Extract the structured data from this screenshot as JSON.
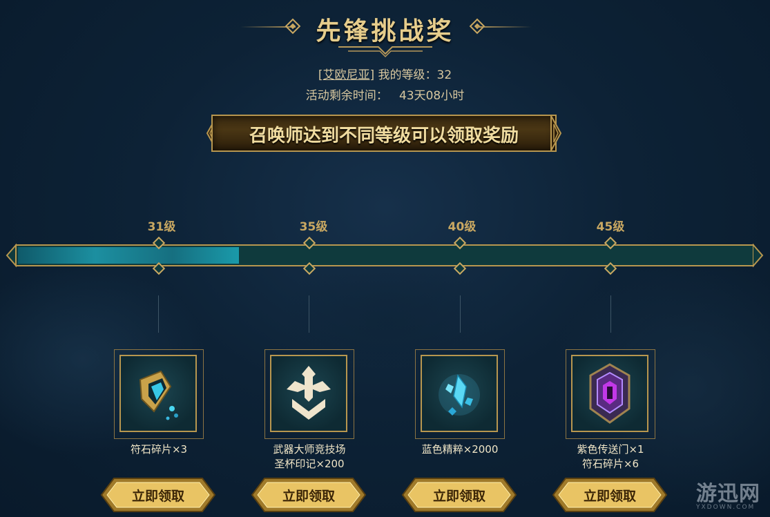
{
  "header": {
    "title": "先锋挑战奖",
    "server": "[艾欧尼亚]",
    "level_text": "我的等级：32",
    "remaining_label": "活动剩余时间：",
    "remaining_value": "43天08小时"
  },
  "banner": {
    "text": "召唤师达到不同等级可以领取奖励"
  },
  "progress": {
    "current_level": 32,
    "fill_fraction": 0.3,
    "levels": [
      "31级",
      "35级",
      "40级",
      "45级"
    ]
  },
  "rewards": [
    {
      "line1": "符石碎片×3",
      "line2": "",
      "icon": "rune-shard-icon",
      "button": "立即领取"
    },
    {
      "line1": "武器大师竞技场",
      "line2": "圣杯印记×200",
      "icon": "grail-token-icon",
      "button": "立即领取"
    },
    {
      "line1": "蓝色精粹×2000",
      "line2": "",
      "icon": "blue-essence-icon",
      "button": "立即领取"
    },
    {
      "line1": "紫色传送门×1",
      "line2": "符石碎片×6",
      "icon": "purple-portal-icon",
      "button": "立即领取"
    }
  ],
  "watermark": {
    "cn": "游迅网",
    "en": "YXDOWN.COM"
  },
  "colors": {
    "gold": "#c9a862",
    "teal_fill": "#1c8fa0",
    "background": "#0d2236"
  }
}
